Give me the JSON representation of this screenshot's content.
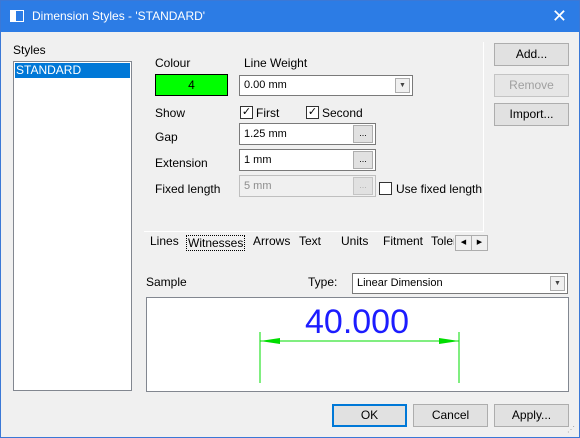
{
  "window": {
    "title": "Dimension Styles - 'STANDARD'",
    "close_glyph": "✕"
  },
  "styles": {
    "label": "Styles",
    "items": [
      "STANDARD"
    ]
  },
  "buttons": {
    "add": "Add...",
    "remove": "Remove",
    "import": "Import...",
    "ok": "OK",
    "cancel": "Cancel",
    "apply": "Apply..."
  },
  "colour": {
    "label": "Colour",
    "value": "4",
    "swatch": "#00ff00"
  },
  "line_weight": {
    "label": "Line Weight",
    "value": "0.00 mm"
  },
  "show": {
    "label": "Show",
    "first": "First",
    "second": "Second",
    "first_checked": true,
    "second_checked": true
  },
  "gap": {
    "label": "Gap",
    "value": "1.25 mm"
  },
  "extension": {
    "label": "Extension",
    "value": "1 mm"
  },
  "fixed_length": {
    "label": "Fixed length",
    "value": "5 mm",
    "use_label": "Use fixed length",
    "use_checked": false
  },
  "ellipsis_glyph": "...",
  "tabs": [
    "Lines",
    "Witnesses",
    "Arrows",
    "Text",
    "Units",
    "Fitment",
    "Toler"
  ],
  "active_tab": "Witnesses",
  "sample": {
    "label": "Sample",
    "type_label": "Type:",
    "type_value": "Linear Dimension",
    "dimension_text": "40.000"
  },
  "icons": {
    "dropdown": "chevron-down-icon",
    "scroll_left": "chevron-left-icon",
    "scroll_right": "chevron-right-icon"
  },
  "colors": {
    "titlebar": "#2c7ce5",
    "dim_text": "#1c1cff",
    "dim_lines": "#00dd00"
  }
}
